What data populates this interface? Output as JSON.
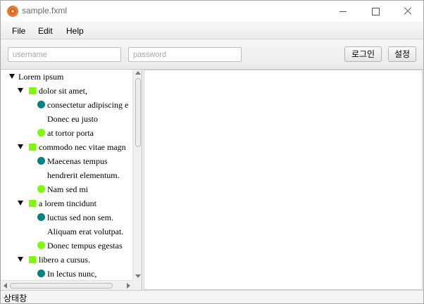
{
  "window": {
    "title": "sample.fxml"
  },
  "menu": {
    "items": [
      "File",
      "Edit",
      "Help"
    ]
  },
  "toolbar": {
    "username_placeholder": "username",
    "password_placeholder": "password",
    "login_label": "로그인",
    "settings_label": "설정"
  },
  "tree": {
    "rows": [
      {
        "label": "Lorem ipsum",
        "kind": "root",
        "expanded": true
      },
      {
        "label": "dolor sit amet,",
        "kind": "folder",
        "expanded": true
      },
      {
        "label": "consectetur adipiscing e",
        "kind": "teal"
      },
      {
        "label": "Donec eu justo",
        "kind": "none"
      },
      {
        "label": "at tortor porta",
        "kind": "green"
      },
      {
        "label": "commodo nec vitae magn",
        "kind": "folder",
        "expanded": true
      },
      {
        "label": "Maecenas tempus",
        "kind": "teal"
      },
      {
        "label": "hendrerit elementum.",
        "kind": "none"
      },
      {
        "label": "Nam sed mi",
        "kind": "green"
      },
      {
        "label": "a lorem tincidunt",
        "kind": "folder",
        "expanded": true
      },
      {
        "label": "luctus sed non sem.",
        "kind": "teal"
      },
      {
        "label": "Aliquam erat volutpat.",
        "kind": "none"
      },
      {
        "label": "Donec tempus egestas",
        "kind": "green"
      },
      {
        "label": "libero a cursus.",
        "kind": "folder",
        "expanded": true
      },
      {
        "label": "In lectus nunc,",
        "kind": "teal"
      }
    ]
  },
  "colors": {
    "folder": "#7cfc00",
    "teal": "#008080",
    "green": "#7cfc00"
  },
  "status": {
    "text": "상태창"
  }
}
